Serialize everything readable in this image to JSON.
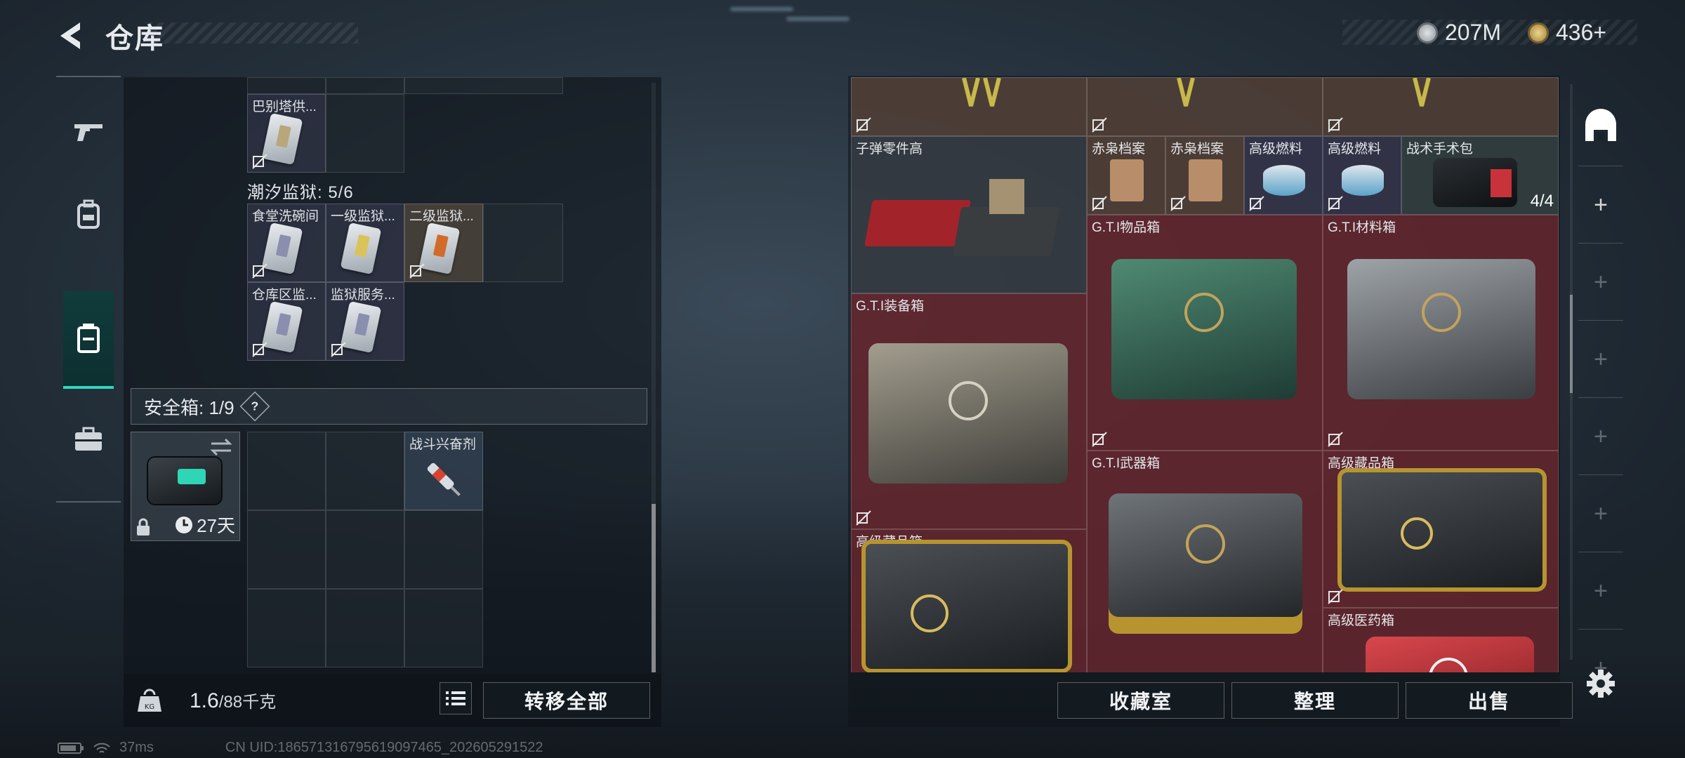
{
  "header": {
    "title": "仓库"
  },
  "currency": [
    {
      "icon": "silver-coin-icon",
      "value": "207M",
      "color": "#b7bec4"
    },
    {
      "icon": "gold-coin-icon",
      "value": "436+",
      "color": "#c9a85a"
    }
  ],
  "left_nav": [
    "gun-icon",
    "backpack-icon",
    "container-icon",
    "briefcase-icon"
  ],
  "stash": {
    "top_items": [
      {
        "label": "巴别塔供..."
      }
    ],
    "prison_title": "潮汐监狱: 5/6",
    "prison_items": [
      {
        "label": "食堂洗碗间"
      },
      {
        "label": "一级监狱..."
      },
      {
        "label": "二级监狱..."
      },
      {
        "label": "仓库区监..."
      },
      {
        "label": "监狱服务..."
      }
    ],
    "safe_title": "安全箱: 1/9",
    "safe_help": "?",
    "safe_timer": "27天",
    "safe_items": [
      {
        "label": "战斗兴奋剂"
      }
    ],
    "weight": "1.6",
    "weight_max": "/88千克",
    "transfer_all_label": "转移全部"
  },
  "warehouse": {
    "items": [
      {
        "label": "子弹零件高"
      },
      {
        "label": "赤枭档案"
      },
      {
        "label": "赤枭档案"
      },
      {
        "label": "高级燃料"
      },
      {
        "label": "高级燃料"
      },
      {
        "label": "战术手术包",
        "count": "4/4"
      },
      {
        "label": "G.T.I物品箱"
      },
      {
        "label": "G.T.I材料箱"
      },
      {
        "label": "G.T.I装备箱"
      },
      {
        "label": "G.T.I武器箱"
      },
      {
        "label": "高级藏品箱"
      },
      {
        "label": "高级藏品箱"
      },
      {
        "label": "高级医药箱"
      }
    ],
    "buttons": {
      "collection": "收藏室",
      "organize": "整理",
      "sell": "出售"
    }
  },
  "side_tabs": [
    "warehouse-icon",
    "+",
    "+",
    "+",
    "+",
    "+",
    "+",
    "+"
  ],
  "status": {
    "ping": "37ms",
    "uid": "CN UID:1865713167956190974​65_202605291522"
  }
}
